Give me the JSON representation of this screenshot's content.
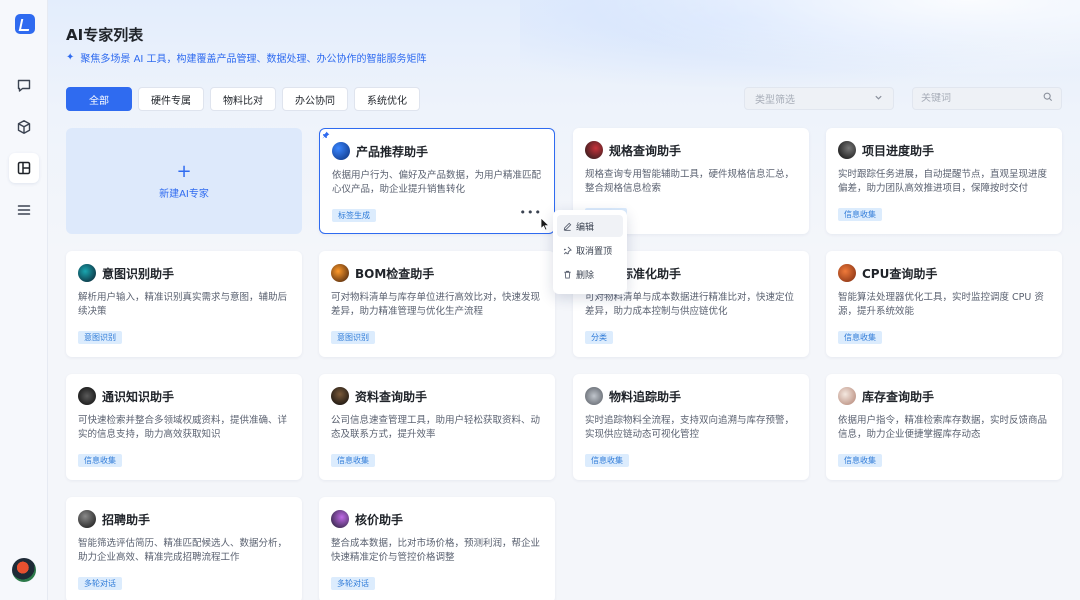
{
  "sidebar": {
    "items": [
      {
        "name": "chat-icon"
      },
      {
        "name": "cube-icon"
      },
      {
        "name": "layout-icon",
        "active": true
      },
      {
        "name": "menu-icon"
      }
    ]
  },
  "header": {
    "title": "AI专家列表",
    "subtitle": "聚焦多场景 AI 工具，构建覆盖产品管理、数据处理、办公协作的智能服务矩阵"
  },
  "tabs": [
    "全部",
    "硬件专属",
    "物料比对",
    "办公协同",
    "系统优化"
  ],
  "filter": {
    "placeholder": "类型筛选"
  },
  "search": {
    "placeholder": "关键词"
  },
  "new_card": {
    "label": "新建AI专家"
  },
  "cards": [
    {
      "name": "产品推荐助手",
      "desc": "依据用户行为、偏好及产品数据，为用户精准匹配心仪产品，助企业提升销售转化",
      "tag": "标签生成",
      "pinned": true,
      "icon_colors": [
        "#1b63d6",
        "#0a2f7a"
      ]
    },
    {
      "name": "规格查询助手",
      "desc": "规格查询专用智能辅助工具，硬件规格信息汇总，整合规格信息检索",
      "tag": "",
      "icon_colors": [
        "#c8323a",
        "#1a1a1a"
      ]
    },
    {
      "name": "项目进度助手",
      "desc": "实时跟踪任务进展，自动提醒节点，直观呈现进度偏差，助力团队高效推进项目，保障按时交付",
      "tag": "信息收集",
      "icon_colors": [
        "#111111",
        "#666666"
      ]
    },
    {
      "name": "意图识别助手",
      "desc": "解析用户输入，精准识别真实需求与意图，辅助后续决策",
      "tag": "意图识别",
      "icon_colors": [
        "#0e6f7a",
        "#0a1a2a"
      ]
    },
    {
      "name": "BOM检查助手",
      "desc": "可对物料清单与库存单位进行高效比对，快速发现差异，助力精准管理与优化生产流程",
      "tag": "意图识别",
      "icon_colors": [
        "#f07a1a",
        "#3a1a0a"
      ]
    },
    {
      "name": "料标准化助手",
      "desc": "可对物料清单与成本数据进行精准比对，快速定位差异，助力成本控制与供应链优化",
      "tag": "分类",
      "icon_colors": [
        "#2f6bf0",
        "#14306a"
      ]
    },
    {
      "name": "CPU查询助手",
      "desc": "智能算法处理器优化工具，实时监控调度 CPU 资源，提升系统效能",
      "tag": "信息收集",
      "icon_colors": [
        "#d4552a",
        "#7a2a10"
      ]
    },
    {
      "name": "通识知识助手",
      "desc": "可快速检索并整合多领域权威资料，提供准确、详实的信息支持，助力高效获取知识",
      "tag": "信息收集",
      "icon_colors": [
        "#1a1a1a",
        "#4a4a4a"
      ]
    },
    {
      "name": "资料查询助手",
      "desc": "公司信息速查管理工具，助用户轻松获取资料、动态及联系方式，提升效率",
      "tag": "信息收集",
      "icon_colors": [
        "#3a2a1a",
        "#0a0a0a"
      ]
    },
    {
      "name": "物料追踪助手",
      "desc": "实时追踪物料全流程，支持双向追溯与库存预警，实现供应链动态可视化管控",
      "tag": "信息收集",
      "icon_colors": [
        "#9aa0a8",
        "#555a62"
      ]
    },
    {
      "name": "库存查询助手",
      "desc": "依据用户指令，精准检索库存数据，实时反馈商品信息，助力企业便捷掌握库存动态",
      "tag": "信息收集",
      "icon_colors": [
        "#e8d6cc",
        "#b08070"
      ]
    },
    {
      "name": "招聘助手",
      "desc": "智能筛选评估简历、精准匹配候选人、数据分析，助力企业高效、精准完成招聘流程工作",
      "tag": "多轮对话",
      "icon_colors": [
        "#555555",
        "#111111"
      ]
    },
    {
      "name": "核价助手",
      "desc": "整合成本数据，比对市场价格，预测利润，帮企业快速精准定价与管控价格调整",
      "tag": "多轮对话",
      "icon_colors": [
        "#7a3aa8",
        "#1a1a2a"
      ]
    }
  ],
  "context_menu": {
    "items": [
      {
        "label": "编辑",
        "icon": "edit-icon"
      },
      {
        "label": "取消置顶",
        "icon": "unpin-icon"
      },
      {
        "label": "删除",
        "icon": "trash-icon"
      }
    ]
  },
  "colors": {
    "accent": "#2f6bf0",
    "tag_bg": "#dcecfd",
    "tag_text": "#2f7bd8"
  }
}
